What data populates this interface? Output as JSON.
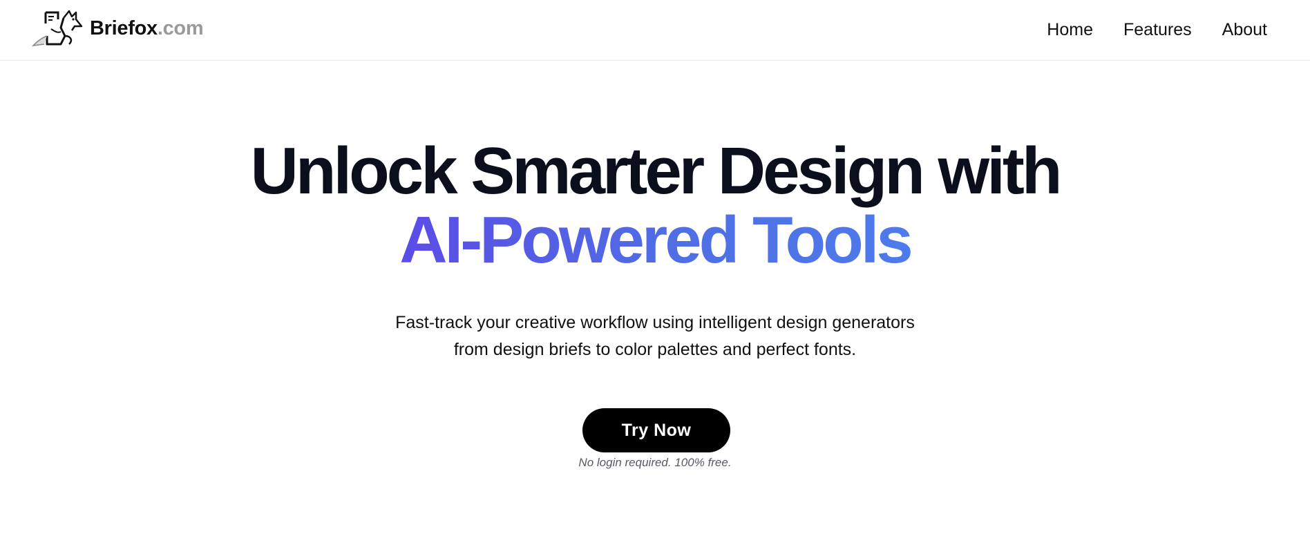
{
  "header": {
    "logo_name": "Briefox",
    "logo_domain": ".com",
    "logo_icon": "fox-logo-icon",
    "nav": [
      {
        "label": "Home"
      },
      {
        "label": "Features"
      },
      {
        "label": "About"
      }
    ]
  },
  "hero": {
    "title_line1": "Unlock Smarter Design with",
    "title_line2": "AI-Powered Tools",
    "subtitle_line1": "Fast-track your creative workflow using intelligent design generators",
    "subtitle_line2": "from design briefs to color palettes and perfect fonts.",
    "cta_label": "Try Now",
    "cta_note": "No login required. 100% free."
  },
  "colors": {
    "title": "#0b0f1c",
    "accent_start": "#5b4ce6",
    "accent_end": "#4d7bec",
    "cta_background": "#000000",
    "domain_text": "#9a9a9a"
  }
}
